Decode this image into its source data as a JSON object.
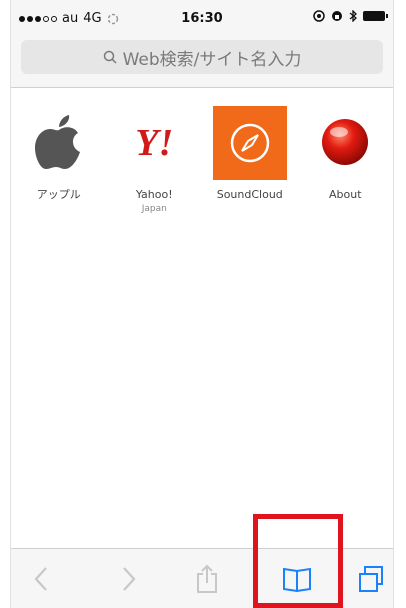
{
  "status_bar": {
    "carrier": "au",
    "network": "4G",
    "time": "16:30"
  },
  "search": {
    "placeholder": "Web検索/サイト名入力"
  },
  "favorites": [
    {
      "label": "アップル",
      "icon": "apple-logo-icon"
    },
    {
      "label": "Yahoo!",
      "sublabel": "Japan",
      "icon": "yahoo-japan-logo-icon",
      "logo_text": "Y!"
    },
    {
      "label": "SoundCloud",
      "icon": "compass-icon"
    },
    {
      "label": "About",
      "icon": "red-ball-icon"
    }
  ],
  "toolbar": {
    "items": [
      "back-arrow-icon",
      "forward-arrow-icon",
      "share-icon",
      "bookmarks-icon",
      "tabs-icon"
    ],
    "highlighted": "bookmarks-icon"
  },
  "colors": {
    "highlight": "#e0141e",
    "soundcloud_tile": "#f06a1a",
    "yahoo_red": "#d11b1b"
  }
}
